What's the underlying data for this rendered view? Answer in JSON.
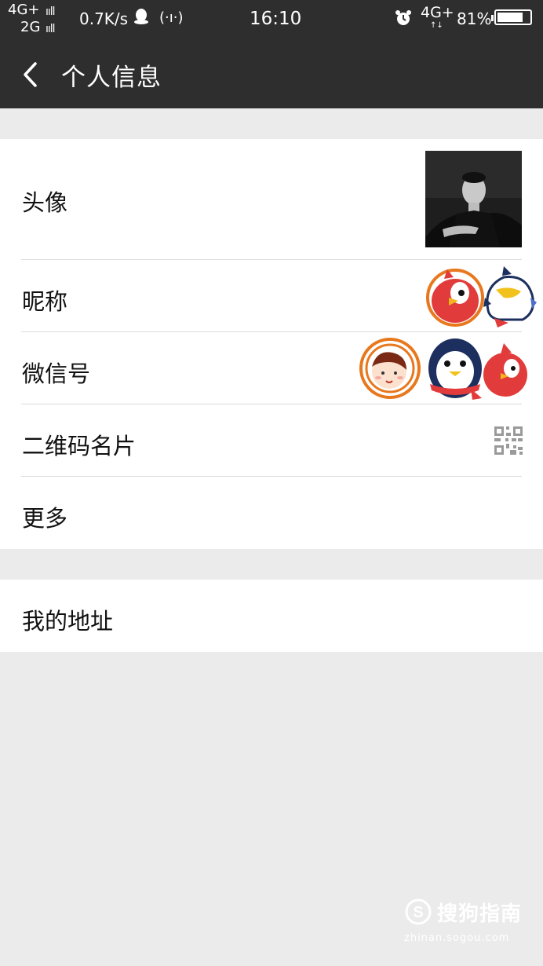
{
  "status_bar": {
    "network_primary": "4G+",
    "network_secondary": "2G",
    "signal_bars_1": "ııll",
    "signal_bars_2": "ııll",
    "speed": "0.7K/s",
    "time": "16:10",
    "network_right": "4G+",
    "data_arrows": "↑↓",
    "battery_percent": "81%",
    "battery_level": 0.81,
    "icons": [
      "qq-icon",
      "hotspot-icon",
      "alarm-icon",
      "battery-icon"
    ]
  },
  "header": {
    "back_icon": "chevron-left-icon",
    "title": "个人信息"
  },
  "profile_group": {
    "items": [
      {
        "label": "头像",
        "value_type": "avatar-image"
      },
      {
        "label": "昵称",
        "value_type": "sticker-overlay"
      },
      {
        "label": "微信号",
        "value": "",
        "value_type": "sticker-overlay"
      },
      {
        "label": "二维码名片",
        "value_type": "qr-icon"
      },
      {
        "label": "更多"
      }
    ]
  },
  "address_group": {
    "items": [
      {
        "label": "我的地址"
      }
    ]
  },
  "watermark": {
    "brand": "搜狗指南",
    "url": "zhinan.sogou.com"
  },
  "colors": {
    "header_bg": "#2e2e2e",
    "page_bg": "#ebebeb",
    "row_bg": "#ffffff",
    "divider": "#dcdcdc",
    "sticker_orange": "#e8781e",
    "sticker_red": "#e23b3b"
  }
}
